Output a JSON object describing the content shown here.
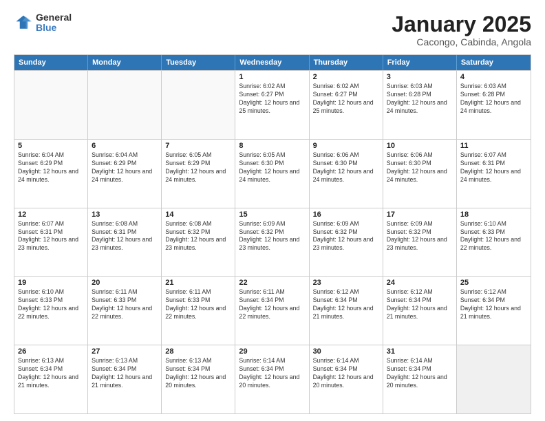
{
  "logo": {
    "general": "General",
    "blue": "Blue"
  },
  "header": {
    "month": "January 2025",
    "location": "Cacongo, Cabinda, Angola"
  },
  "weekdays": [
    "Sunday",
    "Monday",
    "Tuesday",
    "Wednesday",
    "Thursday",
    "Friday",
    "Saturday"
  ],
  "rows": [
    [
      {
        "day": "",
        "sunrise": "",
        "sunset": "",
        "daylight": "",
        "empty": true
      },
      {
        "day": "",
        "sunrise": "",
        "sunset": "",
        "daylight": "",
        "empty": true
      },
      {
        "day": "",
        "sunrise": "",
        "sunset": "",
        "daylight": "",
        "empty": true
      },
      {
        "day": "1",
        "sunrise": "Sunrise: 6:02 AM",
        "sunset": "Sunset: 6:27 PM",
        "daylight": "Daylight: 12 hours and 25 minutes."
      },
      {
        "day": "2",
        "sunrise": "Sunrise: 6:02 AM",
        "sunset": "Sunset: 6:27 PM",
        "daylight": "Daylight: 12 hours and 25 minutes."
      },
      {
        "day": "3",
        "sunrise": "Sunrise: 6:03 AM",
        "sunset": "Sunset: 6:28 PM",
        "daylight": "Daylight: 12 hours and 24 minutes."
      },
      {
        "day": "4",
        "sunrise": "Sunrise: 6:03 AM",
        "sunset": "Sunset: 6:28 PM",
        "daylight": "Daylight: 12 hours and 24 minutes."
      }
    ],
    [
      {
        "day": "5",
        "sunrise": "Sunrise: 6:04 AM",
        "sunset": "Sunset: 6:29 PM",
        "daylight": "Daylight: 12 hours and 24 minutes."
      },
      {
        "day": "6",
        "sunrise": "Sunrise: 6:04 AM",
        "sunset": "Sunset: 6:29 PM",
        "daylight": "Daylight: 12 hours and 24 minutes."
      },
      {
        "day": "7",
        "sunrise": "Sunrise: 6:05 AM",
        "sunset": "Sunset: 6:29 PM",
        "daylight": "Daylight: 12 hours and 24 minutes."
      },
      {
        "day": "8",
        "sunrise": "Sunrise: 6:05 AM",
        "sunset": "Sunset: 6:30 PM",
        "daylight": "Daylight: 12 hours and 24 minutes."
      },
      {
        "day": "9",
        "sunrise": "Sunrise: 6:06 AM",
        "sunset": "Sunset: 6:30 PM",
        "daylight": "Daylight: 12 hours and 24 minutes."
      },
      {
        "day": "10",
        "sunrise": "Sunrise: 6:06 AM",
        "sunset": "Sunset: 6:30 PM",
        "daylight": "Daylight: 12 hours and 24 minutes."
      },
      {
        "day": "11",
        "sunrise": "Sunrise: 6:07 AM",
        "sunset": "Sunset: 6:31 PM",
        "daylight": "Daylight: 12 hours and 24 minutes."
      }
    ],
    [
      {
        "day": "12",
        "sunrise": "Sunrise: 6:07 AM",
        "sunset": "Sunset: 6:31 PM",
        "daylight": "Daylight: 12 hours and 23 minutes."
      },
      {
        "day": "13",
        "sunrise": "Sunrise: 6:08 AM",
        "sunset": "Sunset: 6:31 PM",
        "daylight": "Daylight: 12 hours and 23 minutes."
      },
      {
        "day": "14",
        "sunrise": "Sunrise: 6:08 AM",
        "sunset": "Sunset: 6:32 PM",
        "daylight": "Daylight: 12 hours and 23 minutes."
      },
      {
        "day": "15",
        "sunrise": "Sunrise: 6:09 AM",
        "sunset": "Sunset: 6:32 PM",
        "daylight": "Daylight: 12 hours and 23 minutes."
      },
      {
        "day": "16",
        "sunrise": "Sunrise: 6:09 AM",
        "sunset": "Sunset: 6:32 PM",
        "daylight": "Daylight: 12 hours and 23 minutes."
      },
      {
        "day": "17",
        "sunrise": "Sunrise: 6:09 AM",
        "sunset": "Sunset: 6:32 PM",
        "daylight": "Daylight: 12 hours and 23 minutes."
      },
      {
        "day": "18",
        "sunrise": "Sunrise: 6:10 AM",
        "sunset": "Sunset: 6:33 PM",
        "daylight": "Daylight: 12 hours and 22 minutes."
      }
    ],
    [
      {
        "day": "19",
        "sunrise": "Sunrise: 6:10 AM",
        "sunset": "Sunset: 6:33 PM",
        "daylight": "Daylight: 12 hours and 22 minutes."
      },
      {
        "day": "20",
        "sunrise": "Sunrise: 6:11 AM",
        "sunset": "Sunset: 6:33 PM",
        "daylight": "Daylight: 12 hours and 22 minutes."
      },
      {
        "day": "21",
        "sunrise": "Sunrise: 6:11 AM",
        "sunset": "Sunset: 6:33 PM",
        "daylight": "Daylight: 12 hours and 22 minutes."
      },
      {
        "day": "22",
        "sunrise": "Sunrise: 6:11 AM",
        "sunset": "Sunset: 6:34 PM",
        "daylight": "Daylight: 12 hours and 22 minutes."
      },
      {
        "day": "23",
        "sunrise": "Sunrise: 6:12 AM",
        "sunset": "Sunset: 6:34 PM",
        "daylight": "Daylight: 12 hours and 21 minutes."
      },
      {
        "day": "24",
        "sunrise": "Sunrise: 6:12 AM",
        "sunset": "Sunset: 6:34 PM",
        "daylight": "Daylight: 12 hours and 21 minutes."
      },
      {
        "day": "25",
        "sunrise": "Sunrise: 6:12 AM",
        "sunset": "Sunset: 6:34 PM",
        "daylight": "Daylight: 12 hours and 21 minutes."
      }
    ],
    [
      {
        "day": "26",
        "sunrise": "Sunrise: 6:13 AM",
        "sunset": "Sunset: 6:34 PM",
        "daylight": "Daylight: 12 hours and 21 minutes."
      },
      {
        "day": "27",
        "sunrise": "Sunrise: 6:13 AM",
        "sunset": "Sunset: 6:34 PM",
        "daylight": "Daylight: 12 hours and 21 minutes."
      },
      {
        "day": "28",
        "sunrise": "Sunrise: 6:13 AM",
        "sunset": "Sunset: 6:34 PM",
        "daylight": "Daylight: 12 hours and 20 minutes."
      },
      {
        "day": "29",
        "sunrise": "Sunrise: 6:14 AM",
        "sunset": "Sunset: 6:34 PM",
        "daylight": "Daylight: 12 hours and 20 minutes."
      },
      {
        "day": "30",
        "sunrise": "Sunrise: 6:14 AM",
        "sunset": "Sunset: 6:34 PM",
        "daylight": "Daylight: 12 hours and 20 minutes."
      },
      {
        "day": "31",
        "sunrise": "Sunrise: 6:14 AM",
        "sunset": "Sunset: 6:34 PM",
        "daylight": "Daylight: 12 hours and 20 minutes."
      },
      {
        "day": "",
        "sunrise": "",
        "sunset": "",
        "daylight": "",
        "empty": true,
        "shaded": true
      }
    ]
  ]
}
